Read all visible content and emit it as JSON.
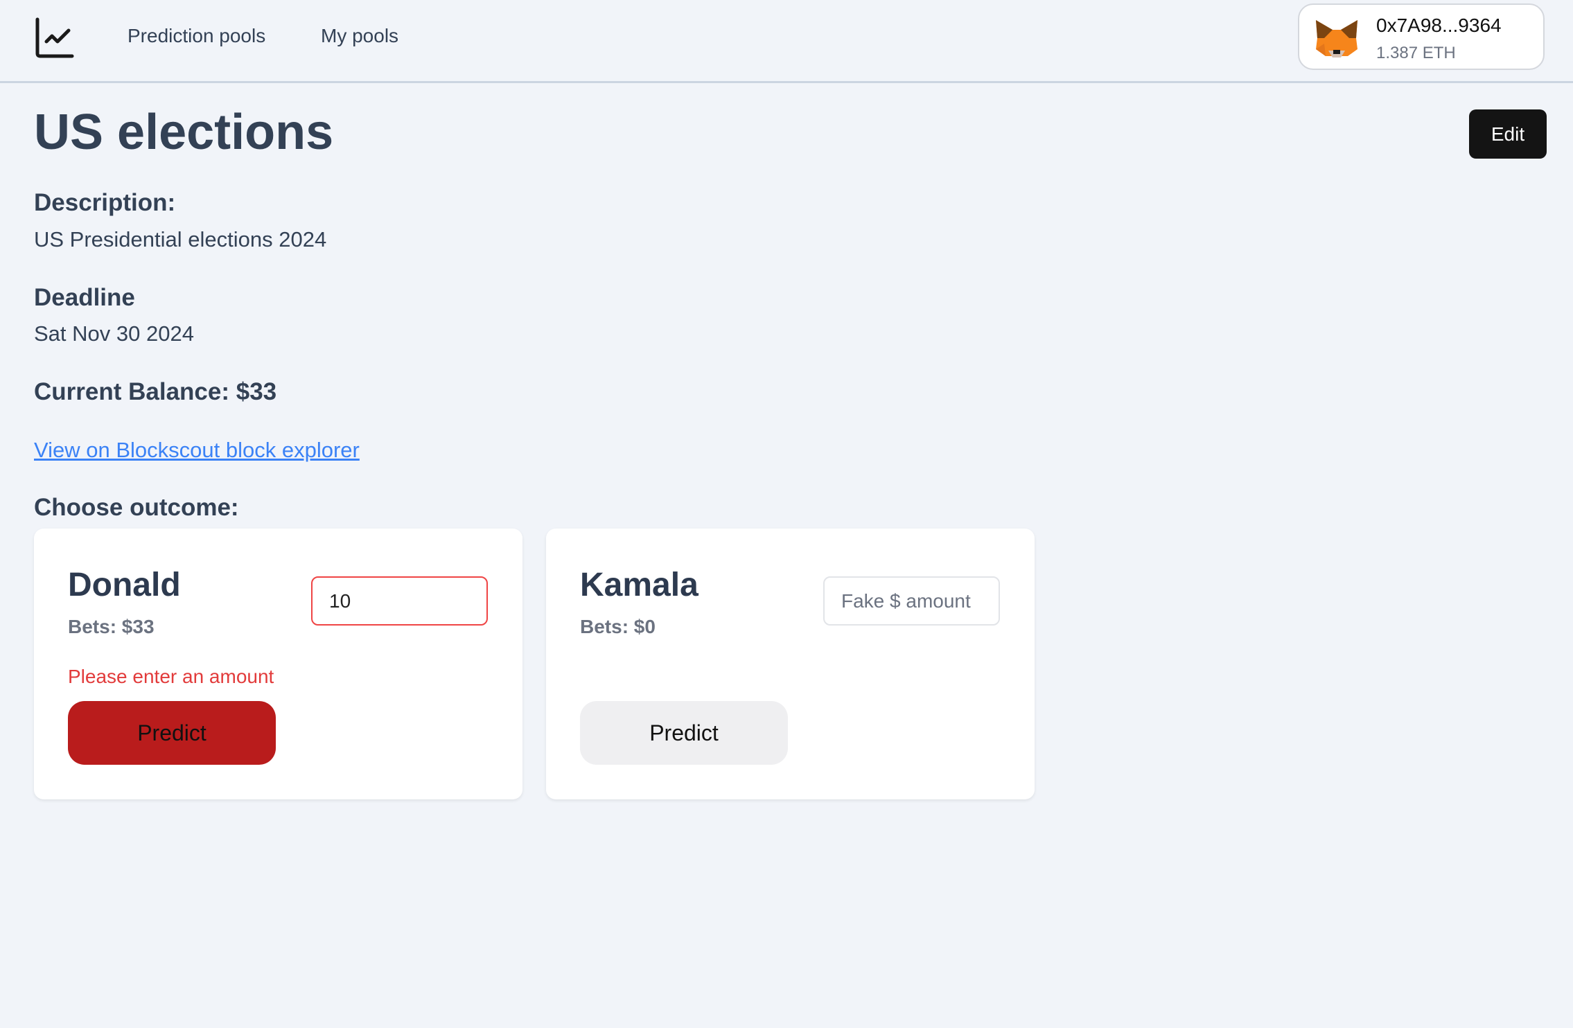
{
  "header": {
    "logo_icon": "chart-line-icon",
    "nav": [
      {
        "label": "Prediction pools"
      },
      {
        "label": "My pools"
      }
    ],
    "wallet": {
      "icon": "metamask-fox-icon",
      "address": "0x7A98...9364",
      "balance": "1.387 ETH"
    }
  },
  "pool": {
    "title": "US elections",
    "edit_label": "Edit",
    "description_label": "Description:",
    "description": "US Presidential elections 2024",
    "deadline_label": "Deadline",
    "deadline": "Sat Nov 30 2024",
    "balance_text": "Current Balance: $33",
    "explorer_link": "View on Blockscout block explorer",
    "choose_label": "Choose outcome:"
  },
  "outcomes": [
    {
      "name": "Donald",
      "bets": "Bets: $33",
      "input_value": "10",
      "placeholder": "Fake $ amount",
      "error": "Please enter an amount",
      "button": "Predict",
      "button_color": "#b91c1c",
      "input_border": "#ef4444"
    },
    {
      "name": "Kamala",
      "bets": "Bets: $0",
      "input_value": "",
      "placeholder": "Fake $ amount",
      "error": "",
      "button": "Predict",
      "button_color": "#efeff1",
      "input_border": "#e2e4e8"
    }
  ]
}
